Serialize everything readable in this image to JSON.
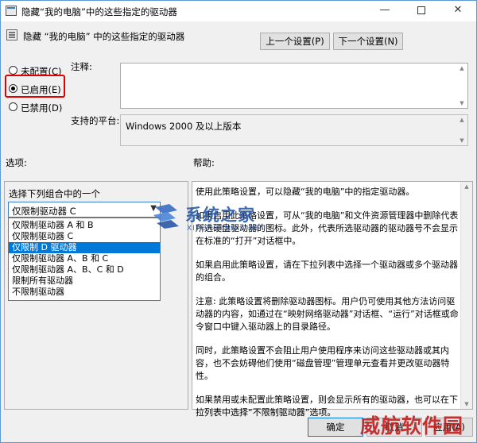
{
  "window": {
    "title": "隐藏“我的电脑”中的这些指定的驱动器"
  },
  "header": {
    "policy_name": "隐藏 “我的电脑” 中的这些指定的驱动器",
    "prev_label": "上一个设置(P)",
    "next_label": "下一个设置(N)"
  },
  "state": {
    "options": [
      {
        "label": "未配置(C)",
        "selected": false
      },
      {
        "label": "已启用(E)",
        "selected": true
      },
      {
        "label": "已禁用(D)",
        "selected": false
      }
    ]
  },
  "comment": {
    "label": "注释:",
    "value": ""
  },
  "platform": {
    "label": "支持的平台:",
    "value": "Windows 2000 及以上版本"
  },
  "options_panel": {
    "label": "选项:",
    "title": "选择下列组合中的一个",
    "selected": "仅限制驱动器 C",
    "items": [
      "仅限制驱动器 A 和 B",
      "仅限制驱动器 C",
      "仅限制 D 驱动器",
      "仅限制驱动器 A、B 和 C",
      "仅限制驱动器 A、B、C 和 D",
      "限制所有驱动器",
      "不限制驱动器"
    ],
    "highlighted_index": 2
  },
  "help_panel": {
    "label": "帮助:",
    "paragraphs": [
      "使用此策略设置，可以隐藏“我的电脑”中的指定驱动器。",
      "如果启用此策略设置，可从“我的电脑”和文件资源管理器中删除代表所选硬盘驱动器的图标。此外，代表所选驱动器的驱动器号不会显示在标准的“打开”对话框中。",
      "如果启用此策略设置，请在下拉列表中选择一个驱动器或多个驱动器的组合。",
      "注意: 此策略设置将删除驱动器图标。用户仍可使用其他方法访问驱动器的内容，如通过在“映射网络驱动器”对话框、“运行”对话框或命令窗口中键入驱动器上的目录路径。",
      "同时，此策略设置不会阻止用户使用程序来访问这些驱动器或其内容，也不会妨碍他们使用“磁盘管理”管理单元查看并更改驱动器特性。",
      "如果禁用或未配置此策略设置，则会显示所有的驱动器，也可以在下拉列表中选择“不限制驱动器”选项。"
    ]
  },
  "footer": {
    "ok_label": "确定",
    "cancel_label": "取消",
    "apply_label": "应用(A)"
  },
  "watermarks": {
    "center_text": "系统之家",
    "center_sub": "XITONGZHIJIA.NET",
    "corner_text": "威航软件园"
  }
}
